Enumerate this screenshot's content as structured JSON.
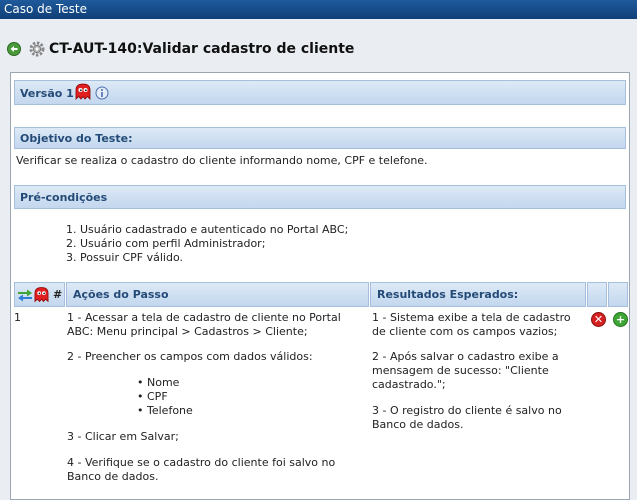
{
  "window": {
    "title": "Caso de Teste"
  },
  "header": {
    "title": "CT-AUT-140:Validar cadastro de cliente"
  },
  "version": {
    "label": "Versão 1"
  },
  "objective": {
    "heading": "Objetivo do Teste:",
    "text": "Verificar se realiza o cadastro do cliente informando nome, CPF e telefone."
  },
  "preconditions": {
    "heading": "Pré-condições",
    "items": [
      "Usuário cadastrado e autenticado no Portal ABC;",
      "Usuário com perfil Administrador;",
      "Possuir CPF válido."
    ]
  },
  "steps": {
    "col_number": "#",
    "col_actions": "Ações do Passo",
    "col_results": "Resultados Esperados:",
    "rows": [
      {
        "number": "1",
        "action_1": "1 - Acessar a tela de cadastro de cliente no Portal ABC: Menu principal > Cadastros > Cliente;",
        "action_2": "2 - Preencher os campos com dados válidos:",
        "fields": [
          "Nome",
          "CPF",
          "Telefone"
        ],
        "action_3": "3 - Clicar em Salvar;",
        "action_4": "4 - Verifique se o cadastro do cliente foi salvo no Banco de dados.",
        "result_1": "1 - Sistema exibe a tela de cadastro de cliente com os campos vazios;",
        "result_2": "2 - Após salvar o cadastro exibe a mensagem de sucesso: \"Cliente cadastrado.\";",
        "result_3": "3 - O registro do cliente é salvo no Banco de dados."
      }
    ]
  },
  "icons": {
    "back": "back-arrow-icon",
    "settings": "gear-icon",
    "ghost": "ghost-icon",
    "info": "info-icon",
    "reorder": "reorder-arrows-icon",
    "delete": "delete-icon",
    "add": "add-icon"
  },
  "colors": {
    "titlebar": "#1f5a9c",
    "section_header": "#c3d7ee",
    "section_text": "#244b78",
    "delete": "#d42020",
    "add": "#3fa535"
  }
}
